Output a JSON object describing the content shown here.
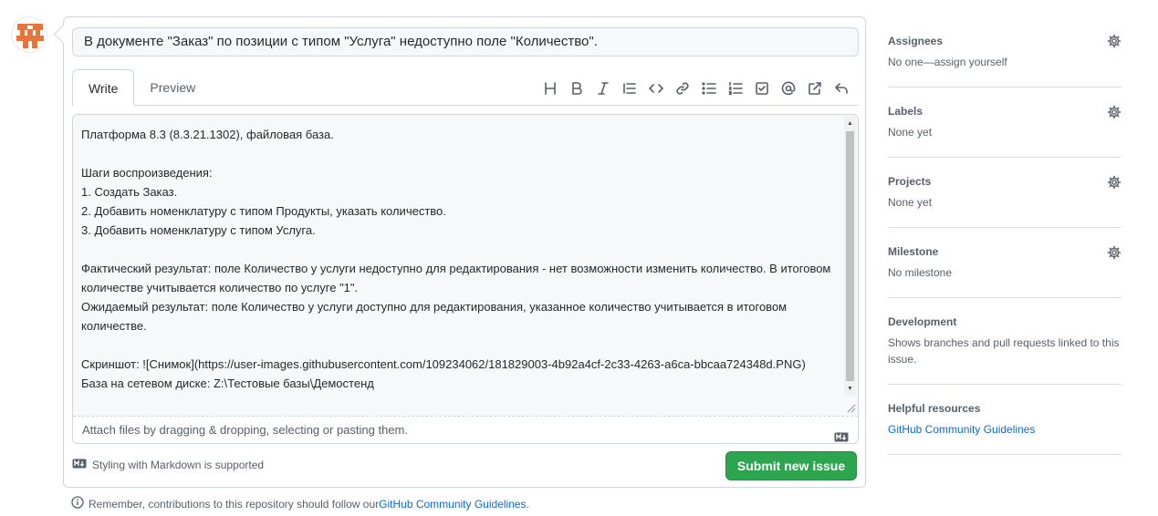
{
  "issue": {
    "title_value": "В документе \"Заказ\" по позиции с типом \"Услуга\" недоступно поле \"Количество\".",
    "body_text": "Платформа 8.3 (8.3.21.1302), файловая база.\n\nШаги воспроизведения:\n1. Создать Заказ.\n2. Добавить номенклатуру с типом Продукты, указать количество.\n3. Добавить номенклатуру с типом Услуга.\n\nФактический результат: поле Количество у услуги недоступно для редактирования - нет возможности изменить количество. В итоговом количестве учитывается количество по услуге \"1\".\nОжидаемый результат: поле Количество у услуги доступно для редактирования, указанное количество учитывается в итоговом количестве.\n\nСкриншот: ![Снимок](https://user-images.githubusercontent.com/109234062/181829003-4b92a4cf-2c33-4263-a6ca-bbcaa724348d.PNG)\nБаза на сетевом диске: Z:\\Тестовые базы\\Демостенд"
  },
  "tabs": [
    {
      "label": "Write"
    },
    {
      "label": "Preview"
    }
  ],
  "toolbar": {
    "icons": [
      "heading-icon",
      "bold-icon",
      "italic-icon",
      "quote-icon",
      "code-icon",
      "link-icon",
      "unordered-list-icon",
      "ordered-list-icon",
      "task-list-icon",
      "mention-icon",
      "reference-icon",
      "reply-icon"
    ]
  },
  "attach_text": "Attach files by dragging & dropping, selecting or pasting them.",
  "markdown_note": "Styling with Markdown is supported",
  "submit_label": "Submit new issue",
  "guidelines_note": {
    "prefix": "Remember, contributions to this repository should follow our ",
    "link": "GitHub Community Guidelines",
    "suffix": "."
  },
  "sidebar": {
    "assignees": {
      "title": "Assignees",
      "value": "No one—assign yourself"
    },
    "labels": {
      "title": "Labels",
      "value": "None yet"
    },
    "projects": {
      "title": "Projects",
      "value": "None yet"
    },
    "milestone": {
      "title": "Milestone",
      "value": "No milestone"
    },
    "development": {
      "title": "Development",
      "value": "Shows branches and pull requests linked to this issue."
    },
    "helpful": {
      "title": "Helpful resources",
      "link": "GitHub Community Guidelines"
    }
  },
  "colors": {
    "accent_green": "#2da44e",
    "link_blue": "#0969da",
    "avatar_orange": "#e8743b"
  }
}
